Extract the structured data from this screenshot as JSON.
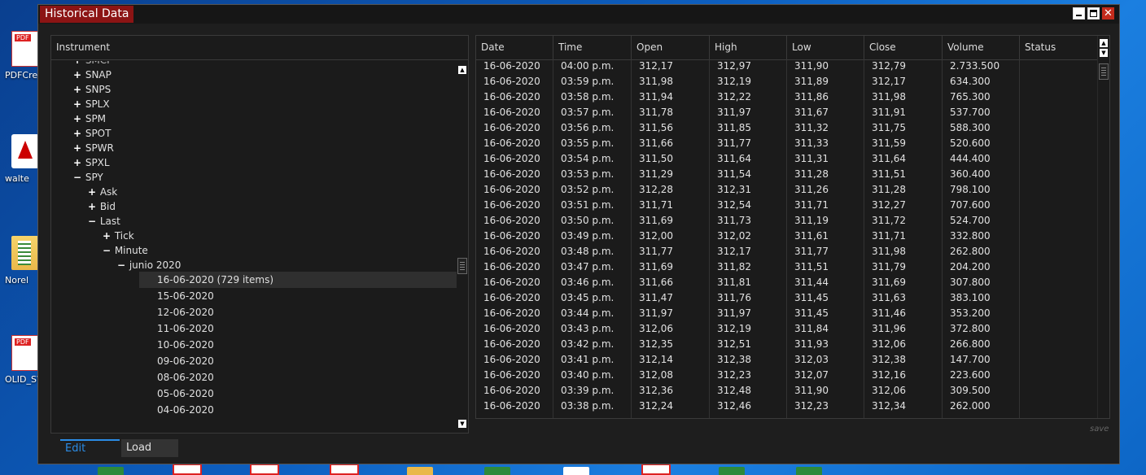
{
  "desktop": {
    "icons": [
      {
        "label": "PDFCre",
        "kind": "pdf"
      },
      {
        "label": "walte",
        "kind": "app"
      },
      {
        "label": "Norel",
        "kind": "folder"
      },
      {
        "label": "OLID_SW",
        "kind": "pdf"
      }
    ]
  },
  "window": {
    "title": "Historical Data"
  },
  "tree": {
    "header": "Instrument",
    "rows": [
      {
        "level": 0,
        "expander": "+",
        "label": "SNAP"
      },
      {
        "level": 0,
        "expander": "+",
        "label": "SNPS"
      },
      {
        "level": 0,
        "expander": "+",
        "label": "SPLX"
      },
      {
        "level": 0,
        "expander": "+",
        "label": "SPM"
      },
      {
        "level": 0,
        "expander": "+",
        "label": "SPOT"
      },
      {
        "level": 0,
        "expander": "+",
        "label": "SPWR"
      },
      {
        "level": 0,
        "expander": "+",
        "label": "SPXL"
      },
      {
        "level": 0,
        "expander": "−",
        "label": "SPY"
      },
      {
        "level": 1,
        "expander": "+",
        "label": "Ask"
      },
      {
        "level": 1,
        "expander": "+",
        "label": "Bid"
      },
      {
        "level": 1,
        "expander": "−",
        "label": "Last"
      },
      {
        "level": 2,
        "expander": "+",
        "label": "Tick"
      },
      {
        "level": 2,
        "expander": "−",
        "label": "Minute"
      },
      {
        "level": 3,
        "expander": "−",
        "label": "junio 2020"
      },
      {
        "level": 4,
        "expander": "",
        "label": "16-06-2020 (729 items)",
        "selected": true
      },
      {
        "level": 4,
        "expander": "",
        "label": "15-06-2020"
      },
      {
        "level": 4,
        "expander": "",
        "label": "12-06-2020"
      },
      {
        "level": 4,
        "expander": "",
        "label": "11-06-2020"
      },
      {
        "level": 4,
        "expander": "",
        "label": "10-06-2020"
      },
      {
        "level": 4,
        "expander": "",
        "label": "09-06-2020"
      },
      {
        "level": 4,
        "expander": "",
        "label": "08-06-2020"
      },
      {
        "level": 4,
        "expander": "",
        "label": "05-06-2020"
      },
      {
        "level": 4,
        "expander": "",
        "label": "04-06-2020"
      }
    ]
  },
  "grid": {
    "columns": [
      "Date",
      "Time",
      "Open",
      "High",
      "Low",
      "Close",
      "Volume",
      "Status"
    ],
    "rows": [
      [
        "16-06-2020",
        "04:00 p.m.",
        "312,17",
        "312,97",
        "311,90",
        "312,79",
        "2.733.500",
        ""
      ],
      [
        "16-06-2020",
        "03:59 p.m.",
        "311,98",
        "312,19",
        "311,89",
        "312,17",
        "634.300",
        ""
      ],
      [
        "16-06-2020",
        "03:58 p.m.",
        "311,94",
        "312,22",
        "311,86",
        "311,98",
        "765.300",
        ""
      ],
      [
        "16-06-2020",
        "03:57 p.m.",
        "311,78",
        "311,97",
        "311,67",
        "311,91",
        "537.700",
        ""
      ],
      [
        "16-06-2020",
        "03:56 p.m.",
        "311,56",
        "311,85",
        "311,32",
        "311,75",
        "588.300",
        ""
      ],
      [
        "16-06-2020",
        "03:55 p.m.",
        "311,66",
        "311,77",
        "311,33",
        "311,59",
        "520.600",
        ""
      ],
      [
        "16-06-2020",
        "03:54 p.m.",
        "311,50",
        "311,64",
        "311,31",
        "311,64",
        "444.400",
        ""
      ],
      [
        "16-06-2020",
        "03:53 p.m.",
        "311,29",
        "311,54",
        "311,28",
        "311,51",
        "360.400",
        ""
      ],
      [
        "16-06-2020",
        "03:52 p.m.",
        "312,28",
        "312,31",
        "311,26",
        "311,28",
        "798.100",
        ""
      ],
      [
        "16-06-2020",
        "03:51 p.m.",
        "311,71",
        "312,54",
        "311,71",
        "312,27",
        "707.600",
        ""
      ],
      [
        "16-06-2020",
        "03:50 p.m.",
        "311,69",
        "311,73",
        "311,19",
        "311,72",
        "524.700",
        ""
      ],
      [
        "16-06-2020",
        "03:49 p.m.",
        "312,00",
        "312,02",
        "311,61",
        "311,71",
        "332.800",
        ""
      ],
      [
        "16-06-2020",
        "03:48 p.m.",
        "311,77",
        "312,17",
        "311,77",
        "311,98",
        "262.800",
        ""
      ],
      [
        "16-06-2020",
        "03:47 p.m.",
        "311,69",
        "311,82",
        "311,51",
        "311,79",
        "204.200",
        ""
      ],
      [
        "16-06-2020",
        "03:46 p.m.",
        "311,66",
        "311,81",
        "311,44",
        "311,69",
        "307.800",
        ""
      ],
      [
        "16-06-2020",
        "03:45 p.m.",
        "311,47",
        "311,76",
        "311,45",
        "311,63",
        "383.100",
        ""
      ],
      [
        "16-06-2020",
        "03:44 p.m.",
        "311,97",
        "311,97",
        "311,45",
        "311,46",
        "353.200",
        ""
      ],
      [
        "16-06-2020",
        "03:43 p.m.",
        "312,06",
        "312,19",
        "311,84",
        "311,96",
        "372.800",
        ""
      ],
      [
        "16-06-2020",
        "03:42 p.m.",
        "312,35",
        "312,51",
        "311,93",
        "312,06",
        "266.800",
        ""
      ],
      [
        "16-06-2020",
        "03:41 p.m.",
        "312,14",
        "312,38",
        "312,03",
        "312,38",
        "147.700",
        ""
      ],
      [
        "16-06-2020",
        "03:40 p.m.",
        "312,08",
        "312,23",
        "312,07",
        "312,16",
        "223.600",
        ""
      ],
      [
        "16-06-2020",
        "03:39 p.m.",
        "312,36",
        "312,48",
        "311,90",
        "312,06",
        "309.500",
        ""
      ],
      [
        "16-06-2020",
        "03:38 p.m.",
        "312,24",
        "312,46",
        "312,23",
        "312,34",
        "262.000",
        ""
      ]
    ],
    "save_label": "save"
  },
  "tabs": {
    "edit": "Edit",
    "load": "Load"
  },
  "colors": {
    "title_tab": "#8c1414",
    "active_tab": "#2b8ce6",
    "panel_bg": "#1b1b1b"
  }
}
